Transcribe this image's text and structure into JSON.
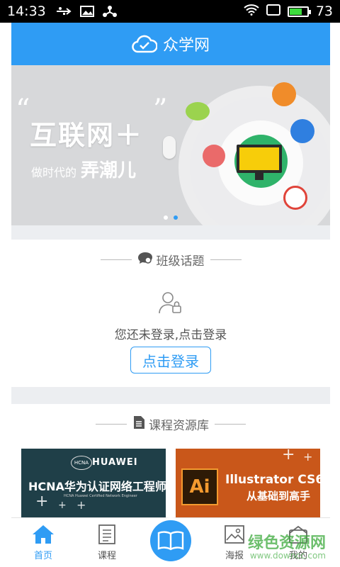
{
  "status_bar": {
    "time": "14:33",
    "battery_level": "73",
    "battery_fraction": 0.73
  },
  "app": {
    "title": "众学网",
    "accent": "#2f9cf4"
  },
  "banner": {
    "quote_open": "“",
    "quote_close": "”",
    "headline": "互联网＋",
    "subline": "做时代的",
    "subline_emphasis": "弄潮儿",
    "slide_count": 2,
    "active_slide": 2
  },
  "class_topics": {
    "title": "班级话题",
    "login_prompt": "您还未登录,点击登录",
    "login_button": "点击登录"
  },
  "course_library": {
    "title": "课程资源库",
    "cards": [
      {
        "brand": "HUAWEI",
        "logo_text": "HCNA",
        "title": "HCNA华为认证网络工程师",
        "subtitle": "HCNA Huawei Certified Network Engineer"
      },
      {
        "badge": "Ai",
        "title": "Illustrator CS6",
        "subtitle": "从基础到高手"
      }
    ]
  },
  "tabbar": {
    "tabs": [
      {
        "label": "首页",
        "icon": "home-icon",
        "active": true
      },
      {
        "label": "课程",
        "icon": "course-icon",
        "active": false
      },
      {
        "label": "",
        "icon": "book-icon",
        "active": false
      },
      {
        "label": "海报",
        "icon": "poster-icon",
        "active": false
      },
      {
        "label": "我的",
        "icon": "profile-icon",
        "active": false
      }
    ]
  },
  "watermark": {
    "text": "绿色资源网",
    "url_text": "www.downcc.com"
  }
}
